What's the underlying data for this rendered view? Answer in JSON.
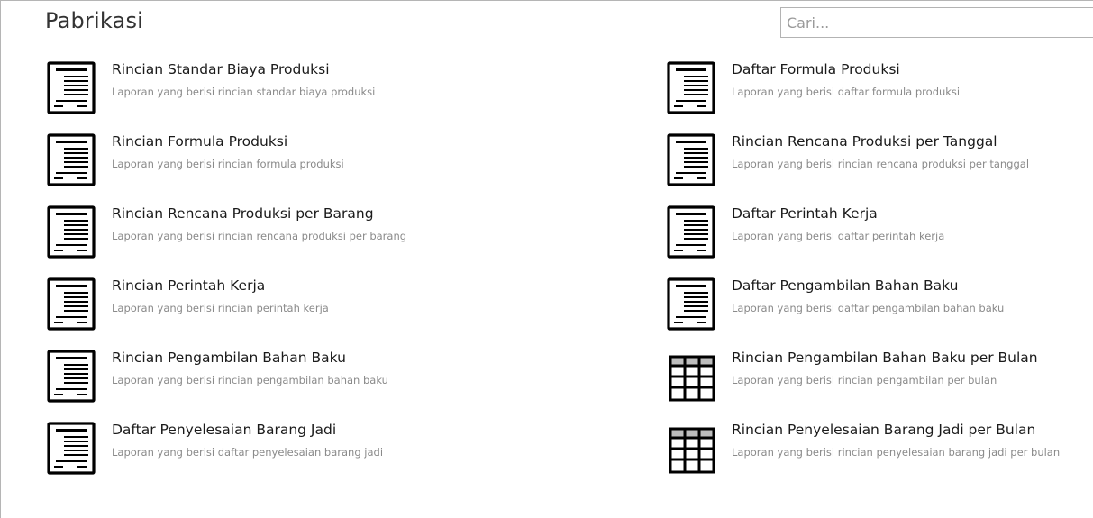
{
  "page": {
    "title": "Pabrikasi"
  },
  "search": {
    "placeholder": "Cari..."
  },
  "reports": [
    {
      "title": "Rincian Standar Biaya Produksi",
      "description": "Laporan yang berisi rincian standar biaya produksi",
      "icon": "document-icon"
    },
    {
      "title": "Daftar Formula Produksi",
      "description": "Laporan yang berisi daftar formula produksi",
      "icon": "document-icon"
    },
    {
      "title": "Rincian Formula Produksi",
      "description": "Laporan yang berisi rincian formula produksi",
      "icon": "document-icon"
    },
    {
      "title": "Rincian Rencana Produksi per Tanggal",
      "description": "Laporan yang berisi rincian rencana produksi per tanggal",
      "icon": "document-icon"
    },
    {
      "title": "Rincian Rencana Produksi per Barang",
      "description": "Laporan yang berisi rincian rencana produksi per barang",
      "icon": "document-icon"
    },
    {
      "title": "Daftar Perintah Kerja",
      "description": "Laporan yang berisi daftar perintah kerja",
      "icon": "document-icon"
    },
    {
      "title": "Rincian Perintah Kerja",
      "description": "Laporan yang berisi rincian perintah kerja",
      "icon": "document-icon"
    },
    {
      "title": "Daftar Pengambilan Bahan Baku",
      "description": "Laporan yang berisi daftar pengambilan bahan baku",
      "icon": "document-icon"
    },
    {
      "title": "Rincian Pengambilan Bahan Baku",
      "description": "Laporan yang berisi rincian pengambilan bahan baku",
      "icon": "document-icon"
    },
    {
      "title": "Rincian Pengambilan Bahan Baku per Bulan",
      "description": "Laporan yang berisi rincian pengambilan per bulan",
      "icon": "table-grid-icon"
    },
    {
      "title": "Daftar Penyelesaian Barang Jadi",
      "description": "Laporan yang berisi daftar penyelesaian barang jadi",
      "icon": "document-icon"
    },
    {
      "title": "Rincian Penyelesaian Barang Jadi per Bulan",
      "description": "Laporan yang berisi rincian penyelesaian barang jadi per bulan",
      "icon": "table-grid-icon"
    }
  ]
}
